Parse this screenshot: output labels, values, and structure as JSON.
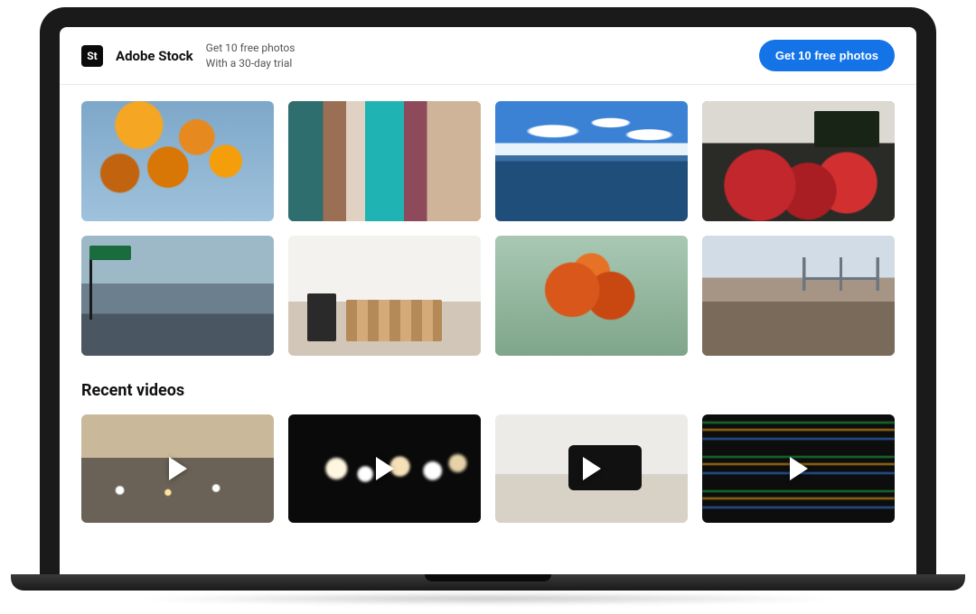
{
  "promo": {
    "brand_badge": "St",
    "brand_name": "Adobe Stock",
    "line1": "Get 10 free photos",
    "line2": "With a 30-day trial",
    "cta_label": "Get 10 free photos"
  },
  "photo_grid": {
    "items": [
      {
        "name": "autumn-leaves",
        "css": "img-autumn-leaves"
      },
      {
        "name": "clothes-rack",
        "css": "img-clothes-rack"
      },
      {
        "name": "ocean-skyline",
        "css": "img-ocean-skyline"
      },
      {
        "name": "market-tomatoes",
        "css": "img-market"
      },
      {
        "name": "brooklyn-street",
        "css": "img-street"
      },
      {
        "name": "coffee-bar",
        "css": "img-coffee-bar"
      },
      {
        "name": "fall-tree",
        "css": "img-fall-tree"
      },
      {
        "name": "bridge-cityscape",
        "css": "img-bridge-city"
      }
    ]
  },
  "videos": {
    "heading": "Recent videos",
    "items": [
      {
        "name": "city-traffic",
        "css": "vid-traffic"
      },
      {
        "name": "bokeh-lights",
        "css": "vid-bokeh"
      },
      {
        "name": "dslr-camera",
        "css": "vid-camera"
      },
      {
        "name": "code-screen",
        "css": "vid-code"
      }
    ]
  }
}
